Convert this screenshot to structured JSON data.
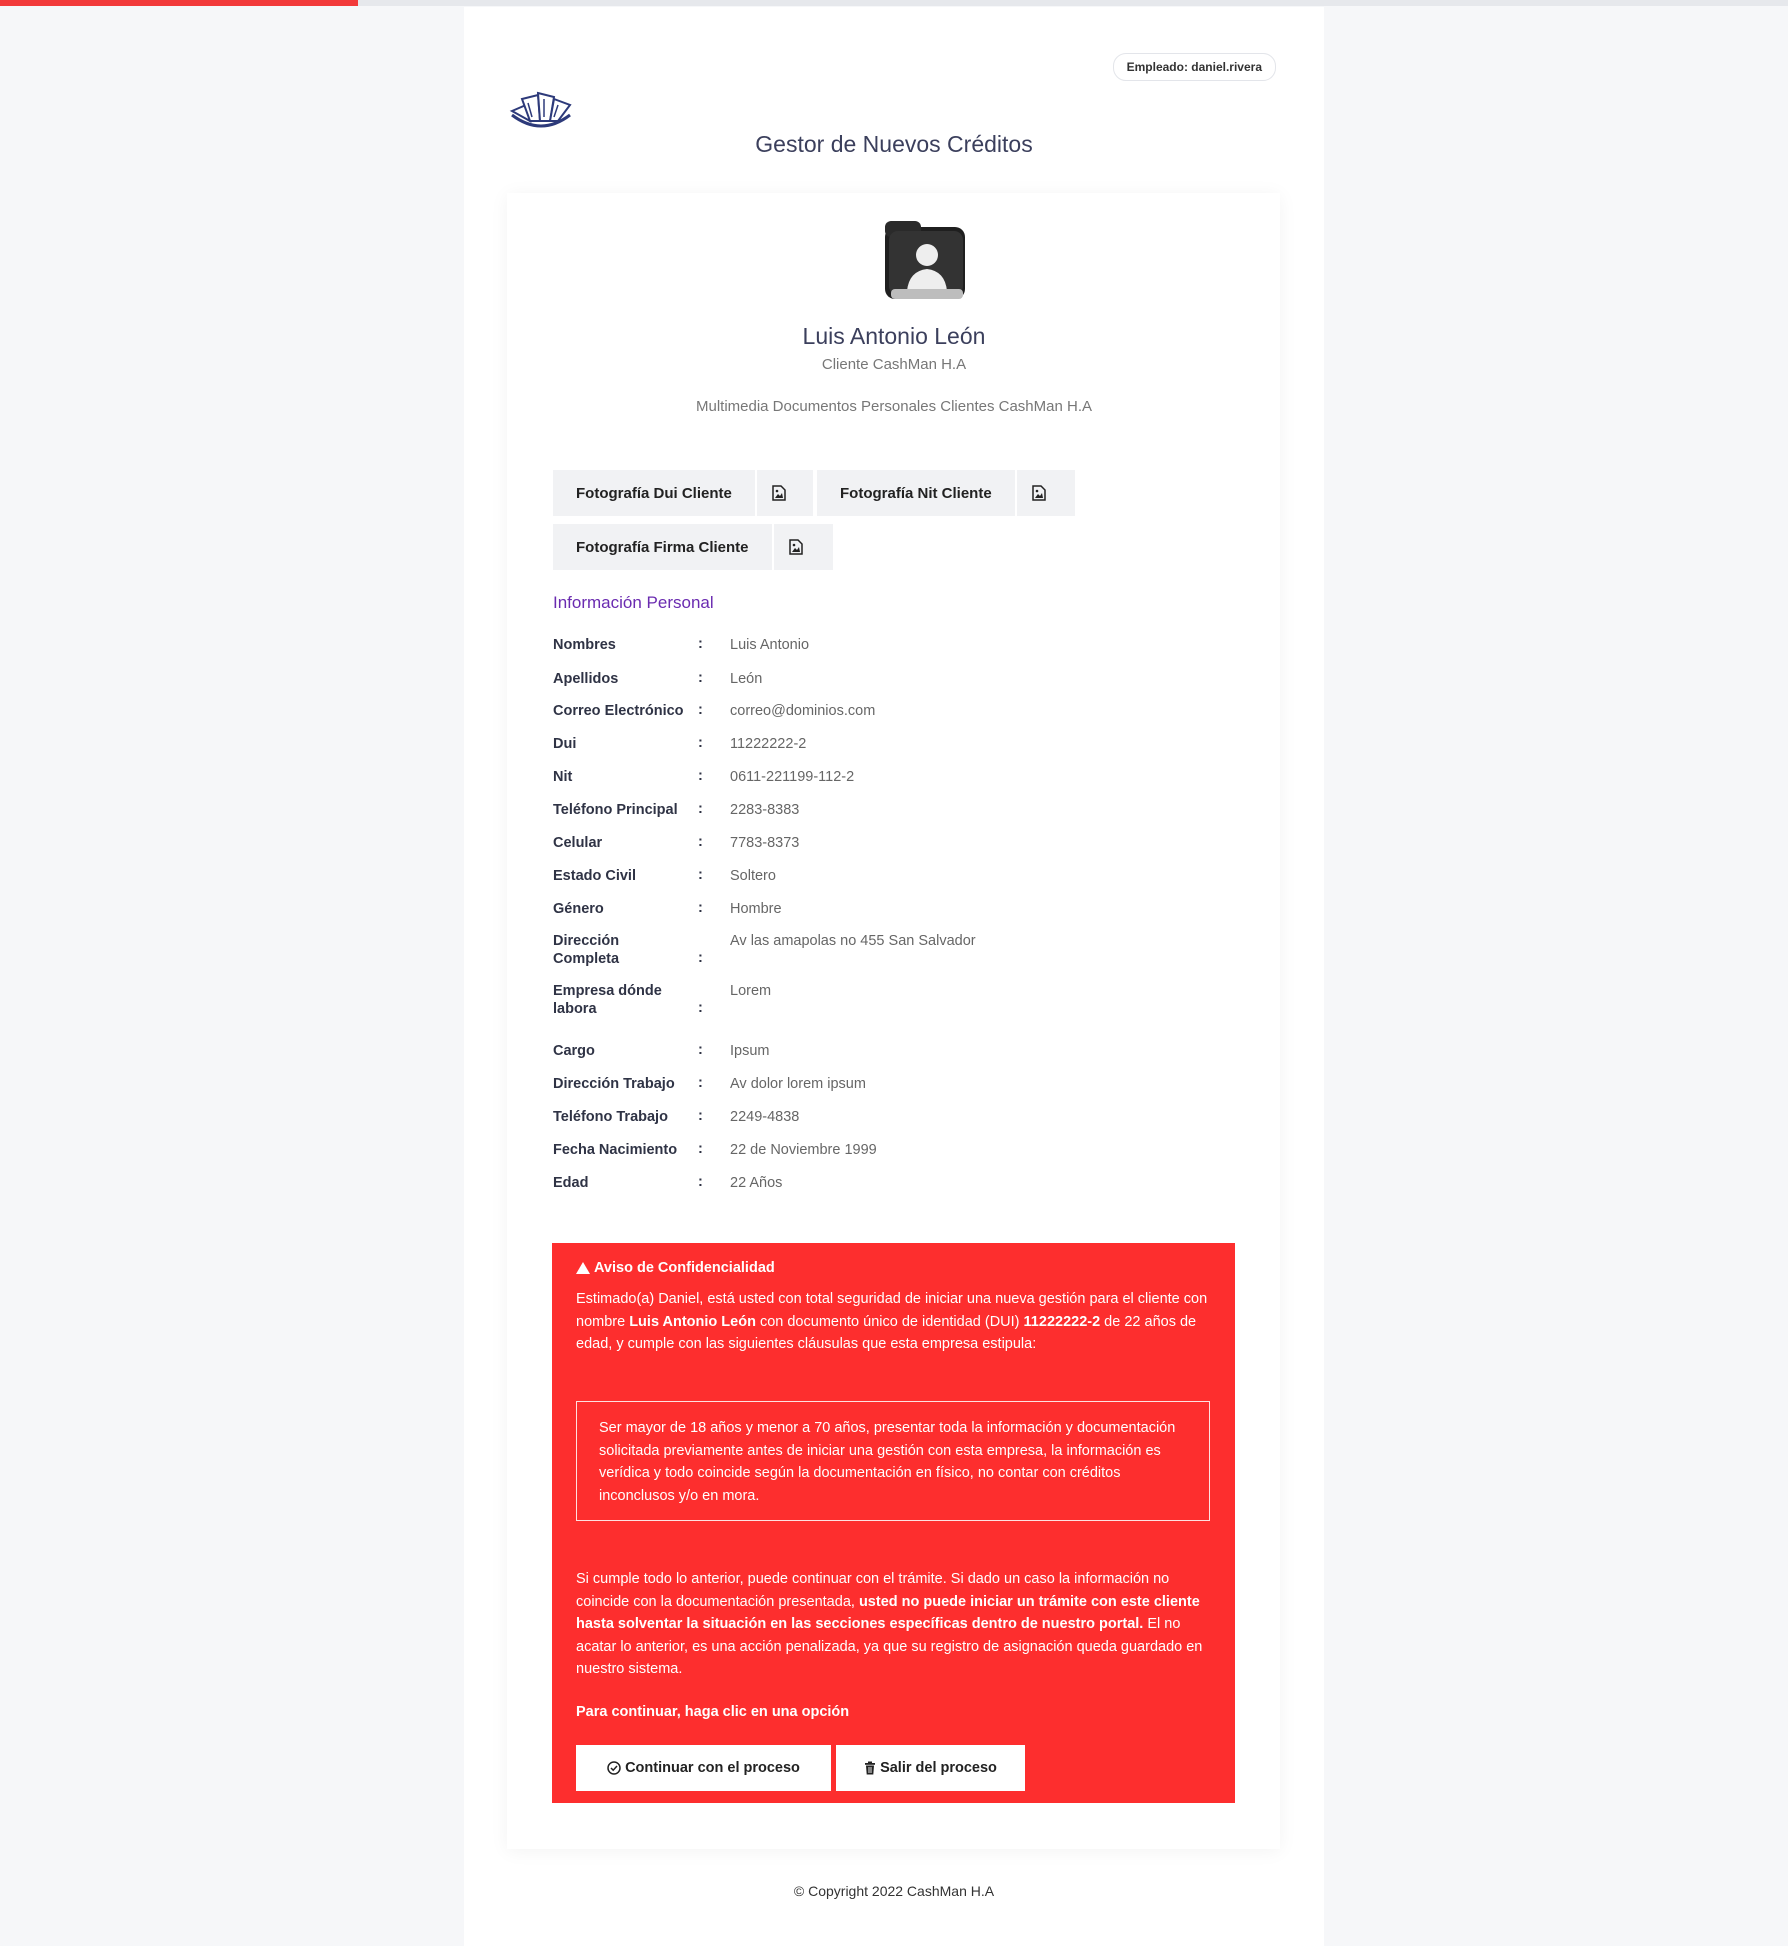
{
  "employee": {
    "label": "Empleado: daniel.rivera"
  },
  "app": {
    "title": "Gestor de Nuevos Créditos"
  },
  "client": {
    "name": "Luis Antonio León",
    "role": "Cliente CashMan H.A",
    "media_subtitle": "Multimedia Documentos Personales Clientes CashMan H.A"
  },
  "documents": [
    {
      "label": "Fotografía Dui Cliente",
      "icon": "image-file-icon"
    },
    {
      "label": "Fotografía Nit Cliente",
      "icon": "image-file-icon"
    },
    {
      "label": "Fotografía Firma Cliente",
      "icon": "image-file-icon"
    }
  ],
  "personal_info": {
    "title": "Información Personal",
    "rows": [
      {
        "key": "Nombres",
        "value": "Luis Antonio"
      },
      {
        "key": "Apellidos",
        "value": "León"
      },
      {
        "key": "Correo Electrónico",
        "value": "correo@dominios.com"
      },
      {
        "key": "Dui",
        "value": "11222222-2"
      },
      {
        "key": "Nit",
        "value": "0611-221199-112-2"
      },
      {
        "key": "Teléfono Principal",
        "value": "2283-8383"
      },
      {
        "key": "Celular",
        "value": "7783-8373"
      },
      {
        "key": "Estado Civil",
        "value": "Soltero"
      },
      {
        "key": "Género",
        "value": "Hombre"
      },
      {
        "key": "Dirección Completa",
        "value": "Av las amapolas no 455 San Salvador"
      },
      {
        "key": "Empresa dónde labora",
        "value": "Lorem"
      },
      {
        "key": "Cargo",
        "value": "Ipsum"
      },
      {
        "key": "Dirección Trabajo",
        "value": "Av dolor lorem ipsum"
      },
      {
        "key": "Teléfono Trabajo",
        "value": "2249-4838"
      },
      {
        "key": "Fecha Nacimiento",
        "value": "22 de Noviembre 1999"
      },
      {
        "key": "Edad",
        "value": "22 Años"
      }
    ]
  },
  "notice": {
    "title": "Aviso de Confidencialidad",
    "p1_a": "Estimado(a) Daniel, está usted con total seguridad de iniciar una nueva gestión para el cliente con nombre ",
    "p1_name": "Luis Antonio León",
    "p1_b": " con documento único de identidad (DUI) ",
    "p1_dui": "11222222-2",
    "p1_c": " de 22 años de edad, y cumple con las siguientes cláusulas que esta empresa estipula:",
    "clause": "Ser mayor de 18 años y menor a 70 años, presentar toda la información y documentación solicitada previamente antes de iniciar una gestión con esta empresa, la información es verídica y todo coincide según la documentación en físico, no contar con créditos inconclusos y/o en mora.",
    "p2_a": "Si cumple todo lo anterior, puede continuar con el trámite. Si dado un caso la información no coincide con la documentación presentada, ",
    "p2_bold": "usted no puede iniciar un trámite con este cliente hasta solventar la situación en las secciones específicas dentro de nuestro portal.",
    "p2_b": " El no acatar lo anterior, es una acción penalizada, ya que su registro de asignación queda guardado en nuestro sistema.",
    "p3": "Para continuar, haga clic en una opción",
    "continue_label": "Continuar con el proceso",
    "exit_label": "Salir del proceso"
  },
  "footer": {
    "copyright": "© Copyright 2022 CashMan H.A"
  },
  "colors": {
    "accent_red": "#fd2e2e",
    "section_purple": "#6a2bb0",
    "progress_red": "#f23a3a"
  },
  "top_progress": {
    "fraction": 0.2
  }
}
